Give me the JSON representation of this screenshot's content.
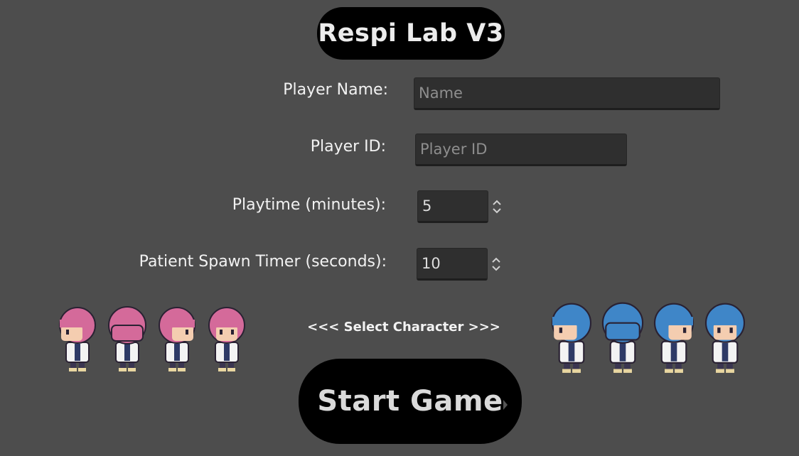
{
  "title": "Respi Lab V3",
  "form": {
    "player_name": {
      "label": "Player Name:",
      "placeholder": "Name",
      "value": ""
    },
    "player_id": {
      "label": "Player ID:",
      "placeholder": "Player ID",
      "value": ""
    },
    "playtime": {
      "label": "Playtime (minutes):",
      "value": "5"
    },
    "spawn_timer": {
      "label": "Patient Spawn Timer (seconds):",
      "value": "10"
    }
  },
  "character_select": {
    "prev_arrows": "<<<",
    "label": "Select Character",
    "next_arrows": ">>>",
    "characters": [
      {
        "name": "pink-hair-character",
        "hair_color": "#d46a9a",
        "facings": [
          "left",
          "back",
          "right",
          "front"
        ]
      },
      {
        "name": "blue-hair-character",
        "hair_color": "#3f86c8",
        "facings": [
          "left",
          "back",
          "right",
          "front"
        ]
      }
    ]
  },
  "start_button": {
    "label": "Start Game"
  },
  "colors": {
    "background": "#4d4d4d",
    "pill": "#000000",
    "field_bg": "#2f2f2f",
    "text": "#f2f2f2",
    "pink_hair": "#d46a9a",
    "blue_hair": "#3f86c8"
  }
}
